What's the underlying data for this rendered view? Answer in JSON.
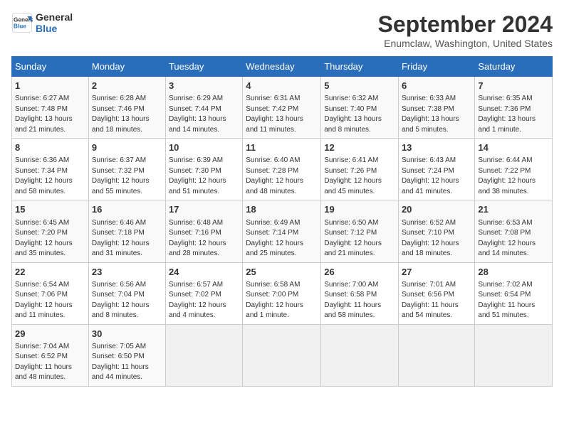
{
  "header": {
    "logo_line1": "General",
    "logo_line2": "Blue",
    "title": "September 2024",
    "location": "Enumclaw, Washington, United States"
  },
  "days_of_week": [
    "Sunday",
    "Monday",
    "Tuesday",
    "Wednesday",
    "Thursday",
    "Friday",
    "Saturday"
  ],
  "weeks": [
    [
      {
        "day": "1",
        "info": "Sunrise: 6:27 AM\nSunset: 7:48 PM\nDaylight: 13 hours\nand 21 minutes."
      },
      {
        "day": "2",
        "info": "Sunrise: 6:28 AM\nSunset: 7:46 PM\nDaylight: 13 hours\nand 18 minutes."
      },
      {
        "day": "3",
        "info": "Sunrise: 6:29 AM\nSunset: 7:44 PM\nDaylight: 13 hours\nand 14 minutes."
      },
      {
        "day": "4",
        "info": "Sunrise: 6:31 AM\nSunset: 7:42 PM\nDaylight: 13 hours\nand 11 minutes."
      },
      {
        "day": "5",
        "info": "Sunrise: 6:32 AM\nSunset: 7:40 PM\nDaylight: 13 hours\nand 8 minutes."
      },
      {
        "day": "6",
        "info": "Sunrise: 6:33 AM\nSunset: 7:38 PM\nDaylight: 13 hours\nand 5 minutes."
      },
      {
        "day": "7",
        "info": "Sunrise: 6:35 AM\nSunset: 7:36 PM\nDaylight: 13 hours\nand 1 minute."
      }
    ],
    [
      {
        "day": "8",
        "info": "Sunrise: 6:36 AM\nSunset: 7:34 PM\nDaylight: 12 hours\nand 58 minutes."
      },
      {
        "day": "9",
        "info": "Sunrise: 6:37 AM\nSunset: 7:32 PM\nDaylight: 12 hours\nand 55 minutes."
      },
      {
        "day": "10",
        "info": "Sunrise: 6:39 AM\nSunset: 7:30 PM\nDaylight: 12 hours\nand 51 minutes."
      },
      {
        "day": "11",
        "info": "Sunrise: 6:40 AM\nSunset: 7:28 PM\nDaylight: 12 hours\nand 48 minutes."
      },
      {
        "day": "12",
        "info": "Sunrise: 6:41 AM\nSunset: 7:26 PM\nDaylight: 12 hours\nand 45 minutes."
      },
      {
        "day": "13",
        "info": "Sunrise: 6:43 AM\nSunset: 7:24 PM\nDaylight: 12 hours\nand 41 minutes."
      },
      {
        "day": "14",
        "info": "Sunrise: 6:44 AM\nSunset: 7:22 PM\nDaylight: 12 hours\nand 38 minutes."
      }
    ],
    [
      {
        "day": "15",
        "info": "Sunrise: 6:45 AM\nSunset: 7:20 PM\nDaylight: 12 hours\nand 35 minutes."
      },
      {
        "day": "16",
        "info": "Sunrise: 6:46 AM\nSunset: 7:18 PM\nDaylight: 12 hours\nand 31 minutes."
      },
      {
        "day": "17",
        "info": "Sunrise: 6:48 AM\nSunset: 7:16 PM\nDaylight: 12 hours\nand 28 minutes."
      },
      {
        "day": "18",
        "info": "Sunrise: 6:49 AM\nSunset: 7:14 PM\nDaylight: 12 hours\nand 25 minutes."
      },
      {
        "day": "19",
        "info": "Sunrise: 6:50 AM\nSunset: 7:12 PM\nDaylight: 12 hours\nand 21 minutes."
      },
      {
        "day": "20",
        "info": "Sunrise: 6:52 AM\nSunset: 7:10 PM\nDaylight: 12 hours\nand 18 minutes."
      },
      {
        "day": "21",
        "info": "Sunrise: 6:53 AM\nSunset: 7:08 PM\nDaylight: 12 hours\nand 14 minutes."
      }
    ],
    [
      {
        "day": "22",
        "info": "Sunrise: 6:54 AM\nSunset: 7:06 PM\nDaylight: 12 hours\nand 11 minutes."
      },
      {
        "day": "23",
        "info": "Sunrise: 6:56 AM\nSunset: 7:04 PM\nDaylight: 12 hours\nand 8 minutes."
      },
      {
        "day": "24",
        "info": "Sunrise: 6:57 AM\nSunset: 7:02 PM\nDaylight: 12 hours\nand 4 minutes."
      },
      {
        "day": "25",
        "info": "Sunrise: 6:58 AM\nSunset: 7:00 PM\nDaylight: 12 hours\nand 1 minute."
      },
      {
        "day": "26",
        "info": "Sunrise: 7:00 AM\nSunset: 6:58 PM\nDaylight: 11 hours\nand 58 minutes."
      },
      {
        "day": "27",
        "info": "Sunrise: 7:01 AM\nSunset: 6:56 PM\nDaylight: 11 hours\nand 54 minutes."
      },
      {
        "day": "28",
        "info": "Sunrise: 7:02 AM\nSunset: 6:54 PM\nDaylight: 11 hours\nand 51 minutes."
      }
    ],
    [
      {
        "day": "29",
        "info": "Sunrise: 7:04 AM\nSunset: 6:52 PM\nDaylight: 11 hours\nand 48 minutes."
      },
      {
        "day": "30",
        "info": "Sunrise: 7:05 AM\nSunset: 6:50 PM\nDaylight: 11 hours\nand 44 minutes."
      },
      null,
      null,
      null,
      null,
      null
    ]
  ]
}
